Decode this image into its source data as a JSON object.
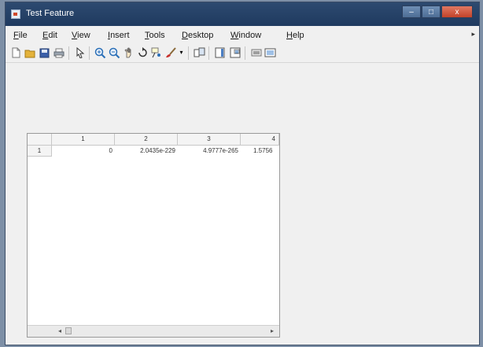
{
  "window": {
    "title": "Test Feature",
    "controls": {
      "minimize": "–",
      "maximize": "□",
      "close": "x"
    }
  },
  "menu": {
    "items": [
      "File",
      "Edit",
      "View",
      "Insert",
      "Tools",
      "Desktop",
      "Window",
      "Help"
    ],
    "overflow": "▸"
  },
  "toolbar": {
    "icons": [
      "new-figure-icon",
      "open-file-icon",
      "save-icon",
      "print-icon",
      "pointer-icon",
      "zoom-in-icon",
      "zoom-out-icon",
      "pan-icon",
      "rotate-3d-icon",
      "data-cursor-icon",
      "brush-icon",
      "brush-dropdown-icon",
      "link-plot-icon",
      "colorbar-icon",
      "legend-icon",
      "hide-plot-tools-icon",
      "show-plot-tools-icon"
    ],
    "colors": {
      "magnifier": "#2a6fb7",
      "brush": "#c8302c",
      "folder": "#e4b23a"
    }
  },
  "table": {
    "columns": [
      "1",
      "2",
      "3",
      "4"
    ],
    "rows": [
      {
        "header": "1",
        "cells": [
          "0",
          "2.0435e-229",
          "4.9777e-265",
          "1.5756"
        ]
      }
    ],
    "scroll": {
      "left": "◂",
      "right": "▸"
    }
  }
}
